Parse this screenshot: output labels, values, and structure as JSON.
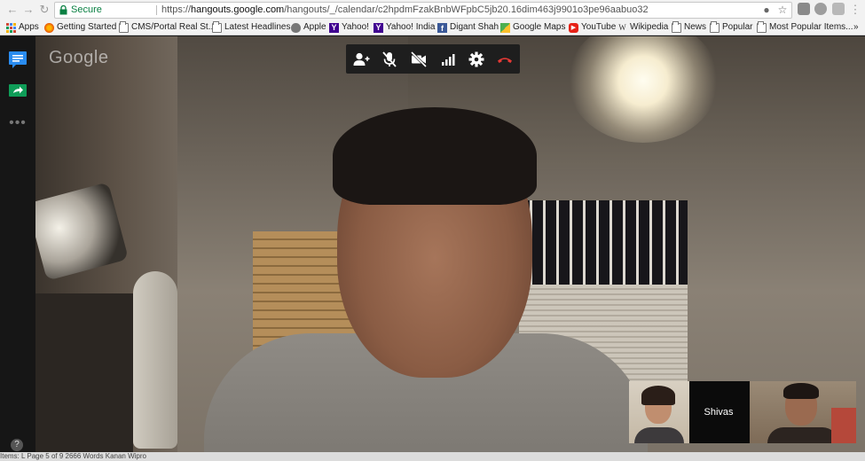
{
  "browser": {
    "secure_label": "Secure",
    "url_scheme": "https://",
    "url_host": "hangouts.google.com",
    "url_path": "/hangouts/_/calendar/c2hpdmFzakBnbWFpbC5jb20.16dim463j9901o3pe96aabuo32",
    "bookmarks": [
      {
        "label": "Apps",
        "icon": "apps-grid-icon"
      },
      {
        "label": "Getting Started",
        "icon": "firefox-icon"
      },
      {
        "label": "CMS/Portal Real St...",
        "icon": "folder-icon"
      },
      {
        "label": "Latest Headlines",
        "icon": "folder-icon"
      },
      {
        "label": "Apple",
        "icon": "apple-icon"
      },
      {
        "label": "Yahoo!",
        "icon": "yahoo-icon"
      },
      {
        "label": "Yahoo! India",
        "icon": "yahoo-icon"
      },
      {
        "label": "Digant Shah",
        "icon": "facebook-icon"
      },
      {
        "label": "Google Maps",
        "icon": "maps-icon"
      },
      {
        "label": "YouTube",
        "icon": "youtube-icon"
      },
      {
        "label": "Wikipedia",
        "icon": "wikipedia-icon"
      },
      {
        "label": "News",
        "icon": "folder-icon"
      },
      {
        "label": "Popular",
        "icon": "folder-icon"
      },
      {
        "label": "Most Popular Items...",
        "icon": "folder-icon"
      }
    ],
    "overflow_label": "»"
  },
  "hangout": {
    "logo": "Google",
    "participant_name": "Shivas",
    "help_label": "?"
  },
  "underlay": {
    "text": "Items: L      Page 5 of 9     2666 Words      Kanan                                                                                                                                                                                        Wipro"
  },
  "colors": {
    "secure_green": "#0b8043",
    "hangup_red": "#e53935",
    "chat_blue": "#2a8cf0",
    "screenshare_green": "#0f9d58"
  }
}
